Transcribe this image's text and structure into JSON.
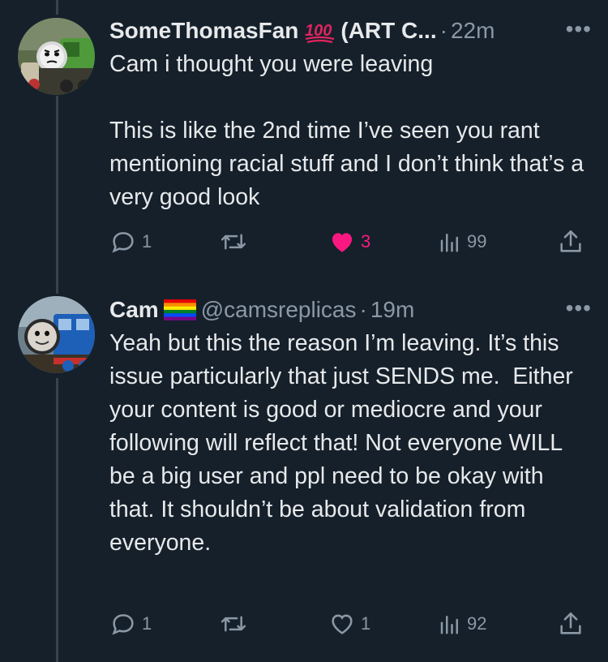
{
  "colors": {
    "background": "#15202b",
    "text": "#e7e9ea",
    "secondary_text": "#8b98a5",
    "like_active": "#f91880",
    "thread_line": "#38444d"
  },
  "tweets": [
    {
      "name": "SomeThomasFan",
      "badge_icon": "hundred-points-emoji-icon",
      "name_suffix": "(ART C...",
      "handle": "",
      "separator": "·",
      "time": "22m",
      "more": "•••",
      "text": "Cam i thought you were leaving\n\nThis is like the 2nd time I’ve seen you rant mentioning racial stuff and I don’t think that’s a very good look",
      "replies": "1",
      "retweets": "",
      "likes": "3",
      "liked": true,
      "views": "99"
    },
    {
      "name": "Cam",
      "badge_icon": "rainbow-flag-emoji-icon",
      "name_suffix": "",
      "handle": "@camsreplicas",
      "separator": "·",
      "time": "19m",
      "more": "•••",
      "text": "Yeah but this the reason I’m leaving. It’s this issue particularly that just SENDS me.  Either your content is good or mediocre and your following will reflect that! Not everyone WILL be a big user and ppl need to be okay with that. It shouldn’t be about validation from everyone.",
      "replies": "1",
      "retweets": "",
      "likes": "1",
      "liked": false,
      "views": "92"
    }
  ]
}
